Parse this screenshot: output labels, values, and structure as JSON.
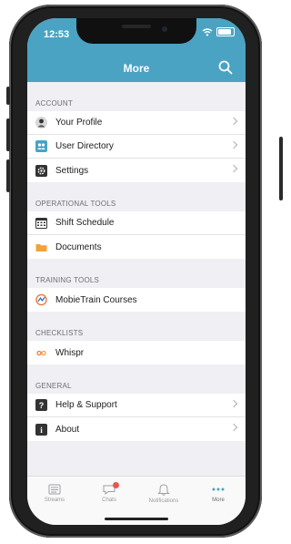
{
  "status": {
    "time": "12:53"
  },
  "header": {
    "title": "More"
  },
  "sections": [
    {
      "title": "ACCOUNT",
      "items": [
        {
          "label": "Your Profile"
        },
        {
          "label": "User Directory"
        },
        {
          "label": "Settings"
        }
      ]
    },
    {
      "title": "OPERATIONAL TOOLS",
      "items": [
        {
          "label": "Shift Schedule"
        },
        {
          "label": "Documents"
        }
      ]
    },
    {
      "title": "TRAINING TOOLS",
      "items": [
        {
          "label": "MobieTrain Courses"
        }
      ]
    },
    {
      "title": "CHECKLISTS",
      "items": [
        {
          "label": "Whispr"
        }
      ]
    },
    {
      "title": "GENERAL",
      "items": [
        {
          "label": "Help & Support"
        },
        {
          "label": "About"
        }
      ]
    }
  ],
  "tabbar": {
    "tabs": [
      {
        "label": "Streams",
        "icon": "streams-icon"
      },
      {
        "label": "Chats",
        "icon": "chats-icon"
      },
      {
        "label": "Notifications",
        "icon": "bell-icon"
      },
      {
        "label": "More",
        "icon": "more-dots-icon"
      }
    ],
    "active": "More"
  },
  "colors": {
    "header": "#4aa3c3",
    "background": "#efeff4",
    "folder": "#f3a23a",
    "badge": "#e8584a"
  }
}
